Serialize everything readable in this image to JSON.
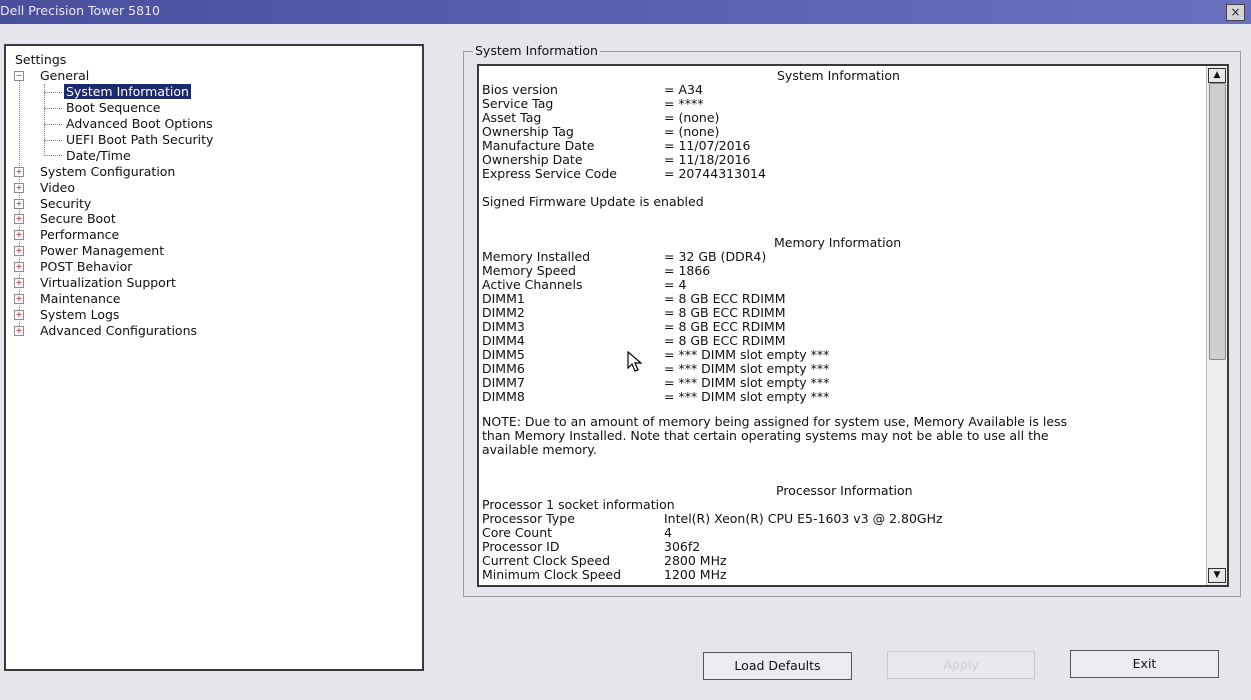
{
  "window": {
    "title": "Dell Precision Tower 5810",
    "close_glyph": "×"
  },
  "tree": {
    "root_label": "Settings",
    "general": {
      "label": "General",
      "children": [
        "System Information",
        "Boot Sequence",
        "Advanced Boot Options",
        "UEFI Boot Path Security",
        "Date/Time"
      ]
    },
    "categories": [
      "System Configuration",
      "Video",
      "Security",
      "Secure Boot",
      "Performance",
      "Power Management",
      "POST Behavior",
      "Virtualization Support",
      "Maintenance",
      "System Logs",
      "Advanced Configurations"
    ]
  },
  "info_group_title": "System Information",
  "system": {
    "heading": "System Information",
    "rows": [
      {
        "label": "Bios version",
        "value": "= A34"
      },
      {
        "label": "Service Tag",
        "value": "= ****"
      },
      {
        "label": "Asset Tag",
        "value": "= (none)"
      },
      {
        "label": "Ownership Tag",
        "value": "= (none)"
      },
      {
        "label": "Manufacture Date",
        "value": "= 11/07/2016"
      },
      {
        "label": "Ownership Date",
        "value": "= 11/18/2016"
      },
      {
        "label": "Express Service Code",
        "value": "= 20744313014"
      }
    ],
    "firmware_note": "Signed Firmware Update is enabled"
  },
  "memory": {
    "heading": "Memory Information",
    "rows": [
      {
        "label": "Memory Installed",
        "value": "= 32 GB (DDR4)"
      },
      {
        "label": "Memory Speed",
        "value": "= 1866"
      },
      {
        "label": "Active Channels",
        "value": "= 4"
      },
      {
        "label": "DIMM1",
        "value": "= 8 GB ECC RDIMM"
      },
      {
        "label": "DIMM2",
        "value": "= 8 GB ECC RDIMM"
      },
      {
        "label": "DIMM3",
        "value": "= 8 GB ECC RDIMM"
      },
      {
        "label": "DIMM4",
        "value": "= 8 GB ECC RDIMM"
      },
      {
        "label": "DIMM5",
        "value": "= *** DIMM slot empty ***"
      },
      {
        "label": "DIMM6",
        "value": "= *** DIMM slot empty ***"
      },
      {
        "label": "DIMM7",
        "value": "= *** DIMM slot empty ***"
      },
      {
        "label": "DIMM8",
        "value": "= *** DIMM slot empty ***"
      }
    ],
    "note_lines": [
      "NOTE: Due to an amount of memory being assigned for system use, Memory Available is less",
      "than Memory Installed. Note that certain operating systems may not be able to use all the",
      "available memory."
    ]
  },
  "processor": {
    "heading": "Processor Information",
    "socket_label": "Processor 1 socket information",
    "rows": [
      {
        "label": "Processor Type",
        "value": "Intel(R) Xeon(R) CPU E5-1603 v3 @ 2.80GHz"
      },
      {
        "label": "Core Count",
        "value": "4"
      },
      {
        "label": "Processor ID",
        "value": "306f2"
      },
      {
        "label": "Current Clock Speed",
        "value": "2800 MHz"
      },
      {
        "label": "Minimum Clock Speed",
        "value": "1200 MHz"
      }
    ]
  },
  "scrollbar": {
    "up_glyph": "▲",
    "down_glyph": "▼"
  },
  "buttons": {
    "load_defaults": "Load Defaults",
    "apply": "Apply",
    "exit": "Exit"
  }
}
